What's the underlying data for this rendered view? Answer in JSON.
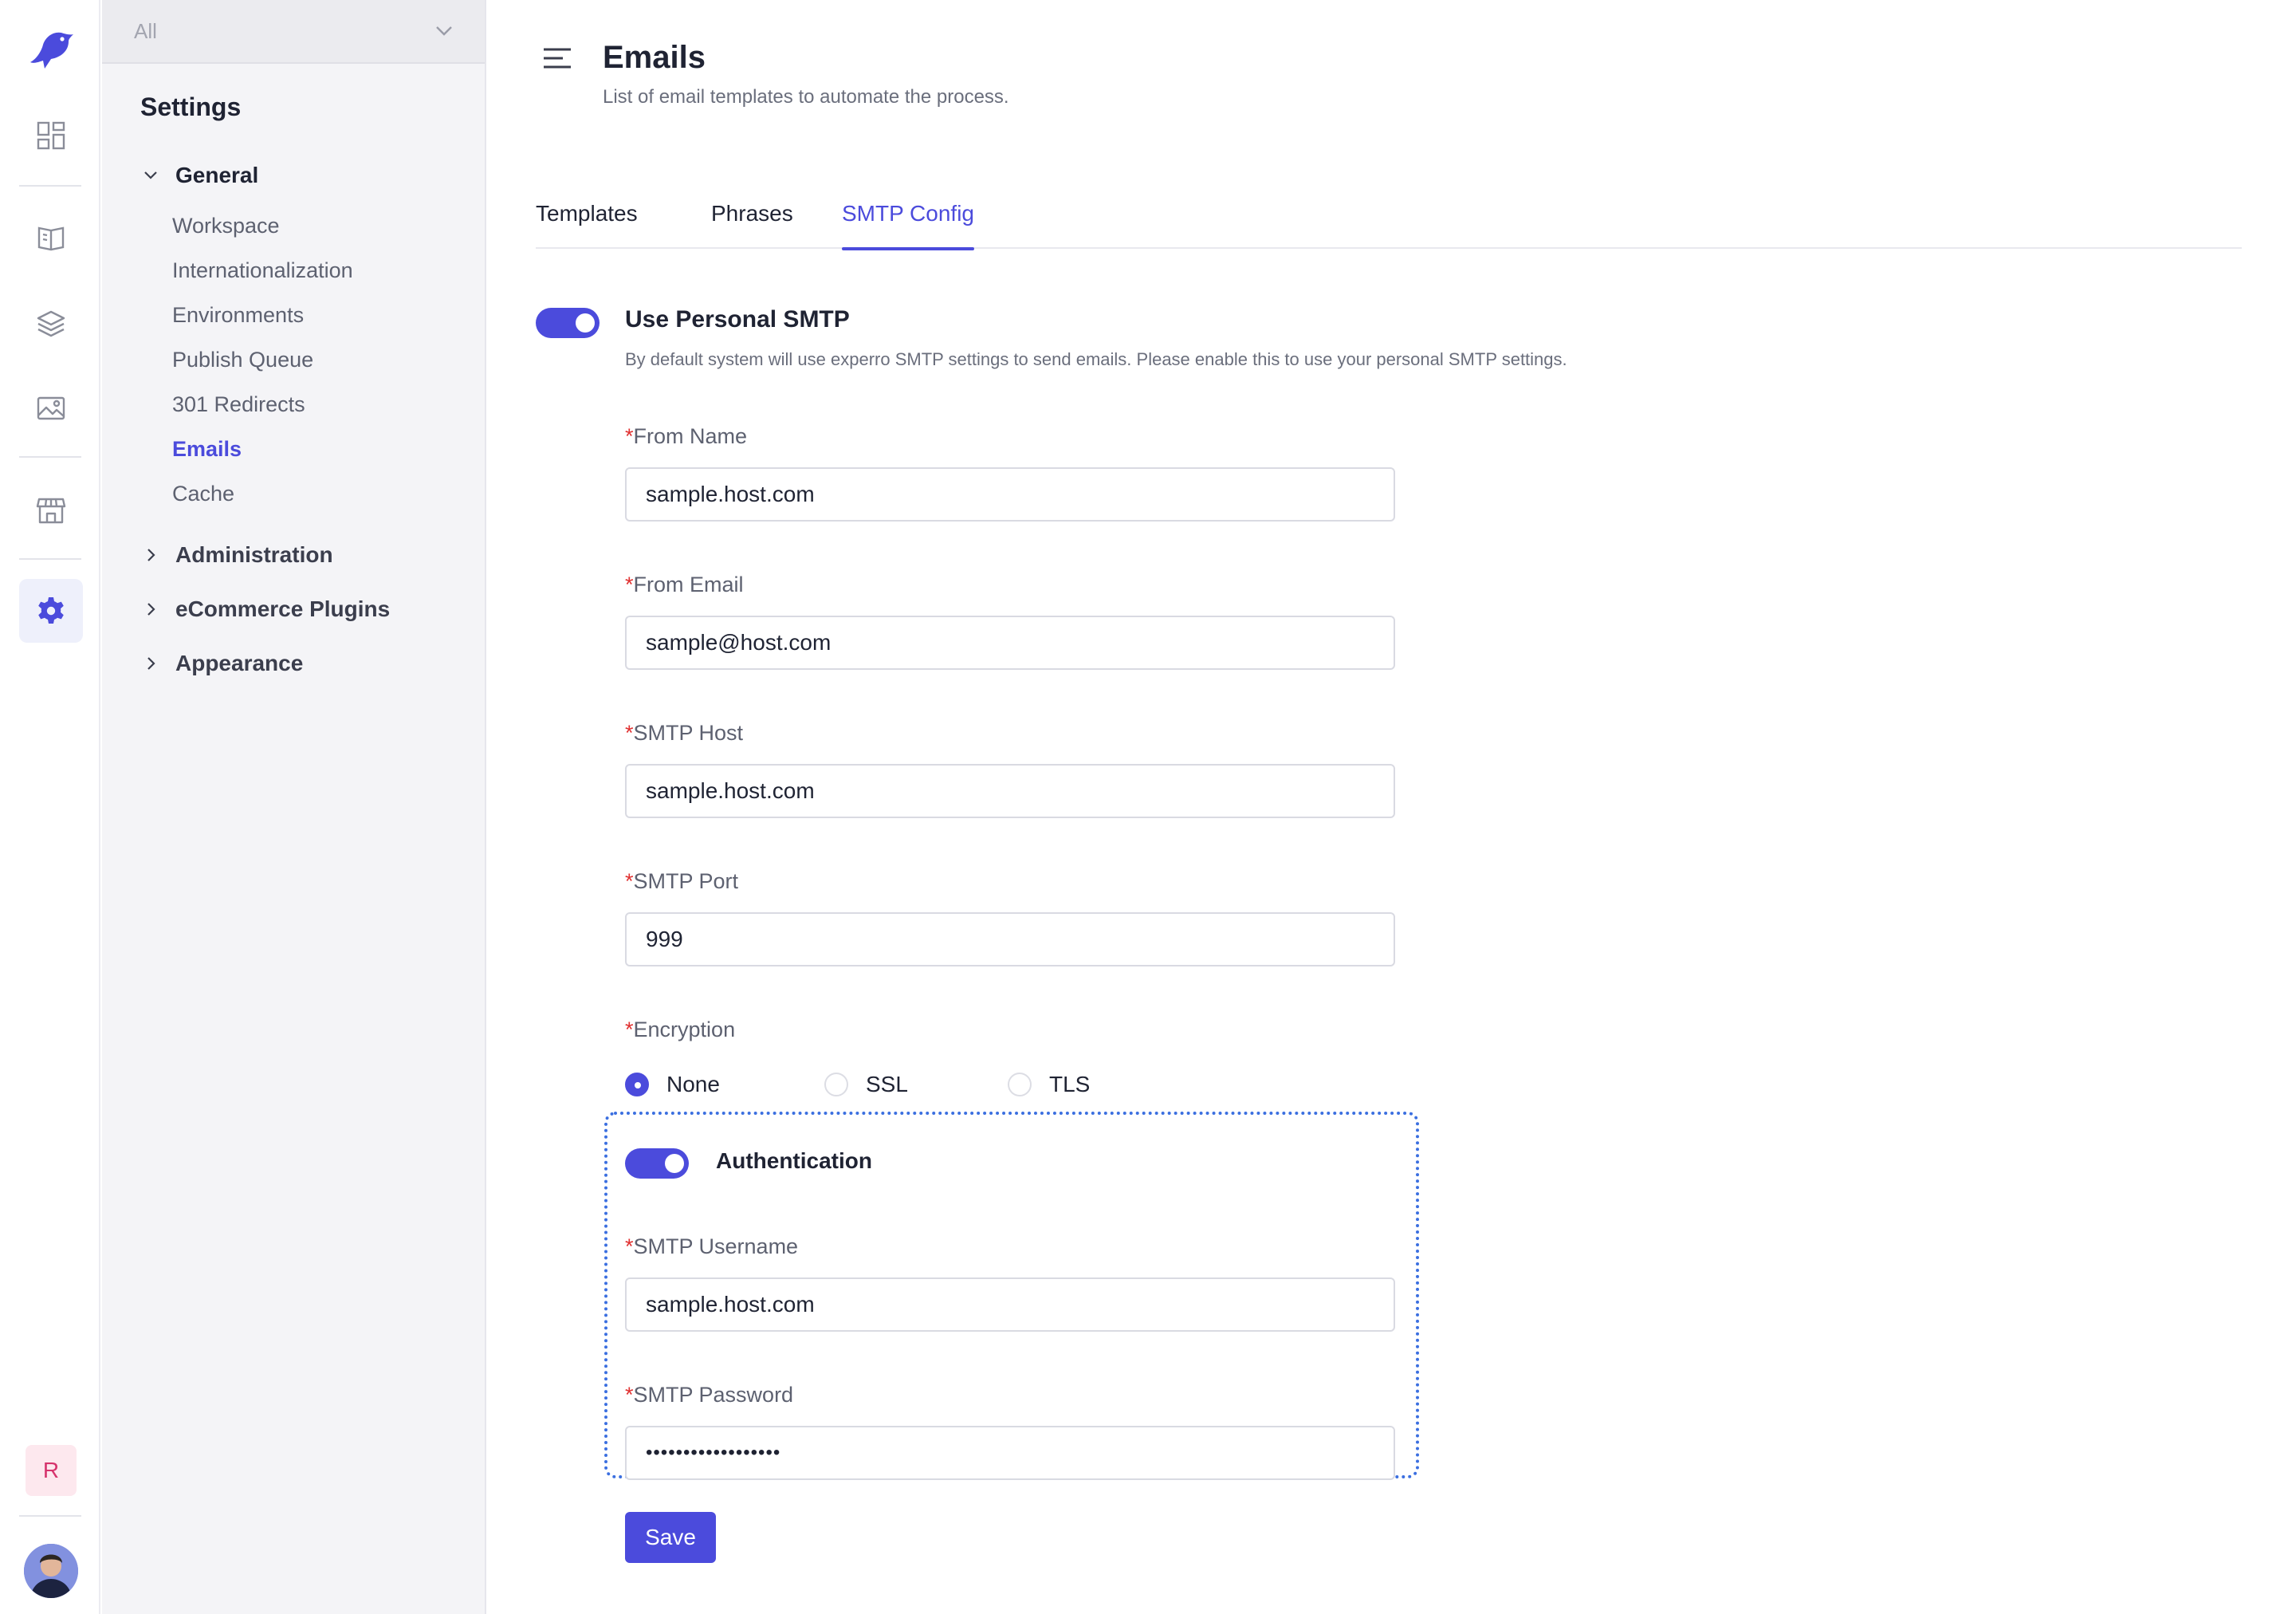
{
  "sidebar_rail": {
    "items": [
      {
        "name": "dashboard-icon"
      },
      {
        "name": "book-icon"
      },
      {
        "name": "layers-icon"
      },
      {
        "name": "image-icon"
      },
      {
        "name": "store-icon"
      },
      {
        "name": "gear-icon",
        "active": true
      }
    ],
    "badge_letter": "R"
  },
  "settings_nav": {
    "workspace_select": "All",
    "title": "Settings",
    "general": {
      "label": "General",
      "items": [
        {
          "label": "Workspace"
        },
        {
          "label": "Internationalization"
        },
        {
          "label": "Environments"
        },
        {
          "label": "Publish Queue"
        },
        {
          "label": "301 Redirects"
        },
        {
          "label": "Emails",
          "active": true
        },
        {
          "label": "Cache"
        }
      ]
    },
    "groups": [
      {
        "label": "Administration"
      },
      {
        "label": "eCommerce Plugins"
      },
      {
        "label": "Appearance"
      }
    ]
  },
  "header": {
    "title": "Emails",
    "subtitle": "List of email templates to automate the process."
  },
  "tabs": [
    {
      "label": "Templates"
    },
    {
      "label": "Phrases"
    },
    {
      "label": "SMTP Config",
      "active": true
    }
  ],
  "smtp": {
    "personal_toggle_label": "Use Personal SMTP",
    "personal_toggle_on": true,
    "personal_description": "By default system will use experro SMTP settings to send emails. Please enable this to use your personal SMTP settings.",
    "required_mark": "*",
    "fields": {
      "from_name": {
        "label": "From Name",
        "value": "sample.host.com"
      },
      "from_email": {
        "label": "From Email",
        "value": "sample@host.com"
      },
      "smtp_host": {
        "label": "SMTP Host",
        "value": "sample.host.com"
      },
      "smtp_port": {
        "label": "SMTP Port",
        "value": "999"
      }
    },
    "encryption": {
      "label": "Encryption",
      "options": [
        {
          "label": "None",
          "selected": true
        },
        {
          "label": "SSL"
        },
        {
          "label": "TLS"
        }
      ]
    },
    "auth": {
      "toggle_label": "Authentication",
      "toggle_on": true,
      "username": {
        "label": "SMTP Username",
        "value": "sample.host.com"
      },
      "password": {
        "label": "SMTP Password",
        "value": "••••••••••••••••••"
      }
    },
    "save_label": "Save"
  },
  "colors": {
    "accent": "#4b4bdc",
    "required": "#e03131",
    "focus_outline": "#3b6fe0"
  }
}
